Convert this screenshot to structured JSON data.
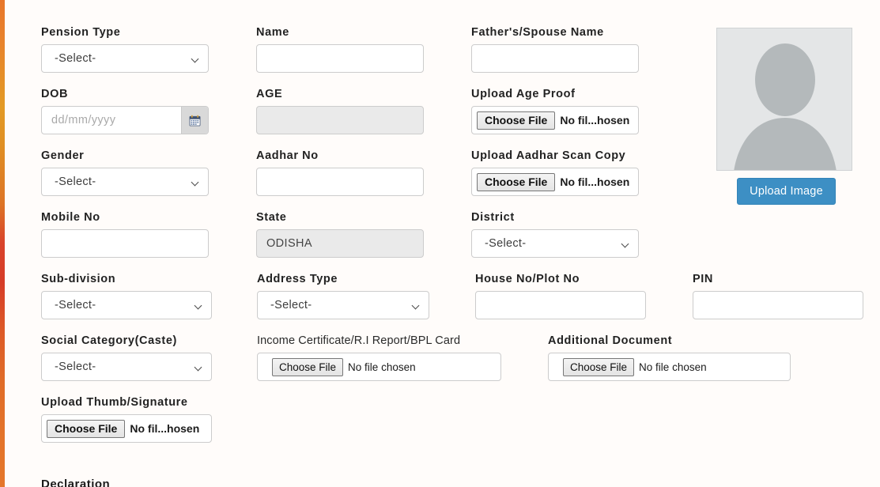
{
  "theme": {
    "page_background": "#fffcfa",
    "accent_button": "#3d8fc4",
    "edge_strip_colors": [
      "#e8762a",
      "#e39a25",
      "#d9432a",
      "#e5772b"
    ],
    "readonly_field_background": "#eaeaea",
    "photo_placeholder_background": "#e4e6e7"
  },
  "form": {
    "select_placeholder": "-Select-",
    "file_button_label": "Choose File",
    "file_no_selection": "No file chosen",
    "file_no_selection_truncated": "No fil...hosen",
    "fields": {
      "pension_type": {
        "label": "Pension Type",
        "value": "-Select-",
        "type": "select"
      },
      "name": {
        "label": "Name",
        "value": "",
        "type": "text"
      },
      "father_spouse_name": {
        "label": "Father's/Spouse Name",
        "value": "",
        "type": "text"
      },
      "dob": {
        "label": "DOB",
        "value": "",
        "placeholder": "dd/mm/yyyy",
        "type": "date"
      },
      "age": {
        "label": "AGE",
        "value": "",
        "type": "readonly"
      },
      "upload_age_proof": {
        "label": "Upload Age Proof",
        "button": "Choose File",
        "status": "No fil...hosen",
        "type": "file"
      },
      "gender": {
        "label": "Gender",
        "value": "-Select-",
        "type": "select"
      },
      "aadhar_no": {
        "label": "Aadhar No",
        "value": "",
        "type": "text"
      },
      "upload_aadhar_scan": {
        "label": "Upload Aadhar Scan Copy",
        "button": "Choose File",
        "status": "No fil...hosen",
        "type": "file"
      },
      "mobile_no": {
        "label": "Mobile No",
        "value": "",
        "type": "text"
      },
      "state": {
        "label": "State",
        "value": "ODISHA",
        "type": "readonly"
      },
      "district": {
        "label": "District",
        "value": "-Select-",
        "type": "select"
      },
      "sub_division": {
        "label": "Sub-division",
        "value": "-Select-",
        "type": "select"
      },
      "address_type": {
        "label": "Address Type",
        "value": "-Select-",
        "type": "select"
      },
      "house_no": {
        "label": "House No/Plot No",
        "value": "",
        "type": "text"
      },
      "pin": {
        "label": "PIN",
        "value": "",
        "type": "text"
      },
      "social_category": {
        "label": "Social Category(Caste)",
        "value": "-Select-",
        "type": "select"
      },
      "income_certificate": {
        "label": "Income Certificate/R.I Report/BPL Card",
        "button": "Choose File",
        "status": "No file chosen",
        "type": "file"
      },
      "additional_document": {
        "label": "Additional Document",
        "button": "Choose File",
        "status": "No file chosen",
        "type": "file"
      },
      "upload_thumb_signature": {
        "label": "Upload Thumb/Signature",
        "button": "Choose File",
        "status": "No fil...hosen",
        "type": "file"
      }
    }
  },
  "photo": {
    "upload_button_label": "Upload Image",
    "placeholder_icon": "user-avatar-icon"
  },
  "sections": {
    "declaration_heading": "Declaration"
  }
}
